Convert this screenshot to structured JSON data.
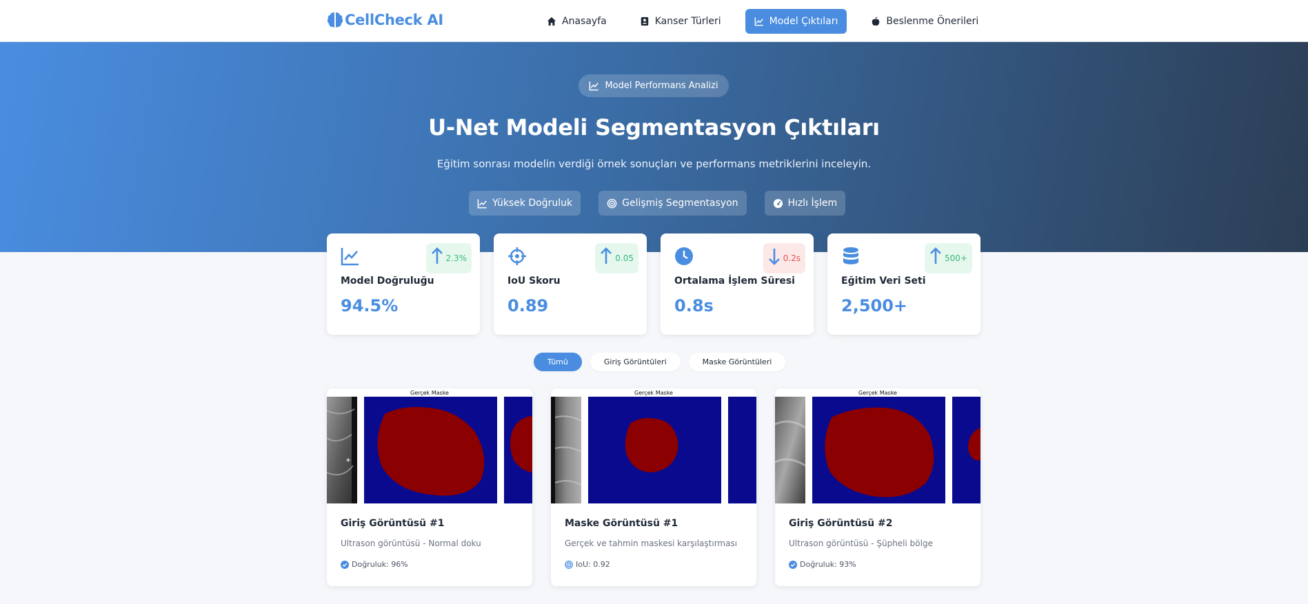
{
  "brand": {
    "name": "CellCheck AI",
    "icon": "brain-icon",
    "color": "#4a8de0"
  },
  "nav": {
    "items": [
      {
        "label": "Anasayfa",
        "icon": "home-icon",
        "active": false
      },
      {
        "label": "Kanser Türleri",
        "icon": "id-card-icon",
        "active": false
      },
      {
        "label": "Model Çıktıları",
        "icon": "chart-line-icon",
        "active": true
      },
      {
        "label": "Beslenme Önerileri",
        "icon": "apple-icon",
        "active": false
      }
    ]
  },
  "hero": {
    "badge": "Model Performans Analizi",
    "title": "U-Net Modeli Segmentasyon Çıktıları",
    "subtitle": "Eğitim sonrası modelin verdiği örnek sonuçları ve performans metriklerini inceleyin.",
    "pills": [
      {
        "label": "Yüksek Doğruluk",
        "icon": "chart-line-icon"
      },
      {
        "label": "Gelişmiş Segmentasyon",
        "icon": "target-icon"
      },
      {
        "label": "Hızlı İşlem",
        "icon": "gauge-icon"
      }
    ]
  },
  "stats": [
    {
      "label": "Model Doğruluğu",
      "value": "94.5%",
      "trend": "2.3%",
      "direction": "up",
      "icon": "chart-line-icon"
    },
    {
      "label": "IoU Skoru",
      "value": "0.89",
      "trend": "0.05",
      "direction": "up",
      "icon": "crosshairs-icon"
    },
    {
      "label": "Ortalama İşlem Süresi",
      "value": "0.8s",
      "trend": "0.2s",
      "direction": "down",
      "icon": "clock-icon"
    },
    {
      "label": "Eğitim Veri Seti",
      "value": "2,500+",
      "trend": "500+",
      "direction": "up",
      "icon": "database-icon"
    }
  ],
  "filters": [
    {
      "label": "Tümü",
      "active": true
    },
    {
      "label": "Giriş Görüntüleri",
      "active": false
    },
    {
      "label": "Maske Görüntüleri",
      "active": false
    }
  ],
  "results": [
    {
      "image_title": "Gerçek Maske",
      "title": "Giriş Görüntüsü #1",
      "description": "Ultrason görüntüsü - Normal doku",
      "meta": "Doğruluk: 96%",
      "meta_icon": "check-circle-icon"
    },
    {
      "image_title": "Gerçek Maske",
      "title": "Maske Görüntüsü #1",
      "description": "Gerçek ve tahmin maskesi karşılaştırması",
      "meta": "IoU: 0.92",
      "meta_icon": "target-icon"
    },
    {
      "image_title": "Gerçek Maske",
      "title": "Giriş Görüntüsü #2",
      "description": "Ultrason görüntüsü - Şüpheli bölge",
      "meta": "Doğruluk: 93%",
      "meta_icon": "check-circle-icon"
    }
  ],
  "colors": {
    "accent": "#4a8de0",
    "trend_up": "#3ab97a",
    "trend_down": "#e15252",
    "mask_background": "#0a0a8f",
    "mask_lesion": "#8b0000"
  }
}
